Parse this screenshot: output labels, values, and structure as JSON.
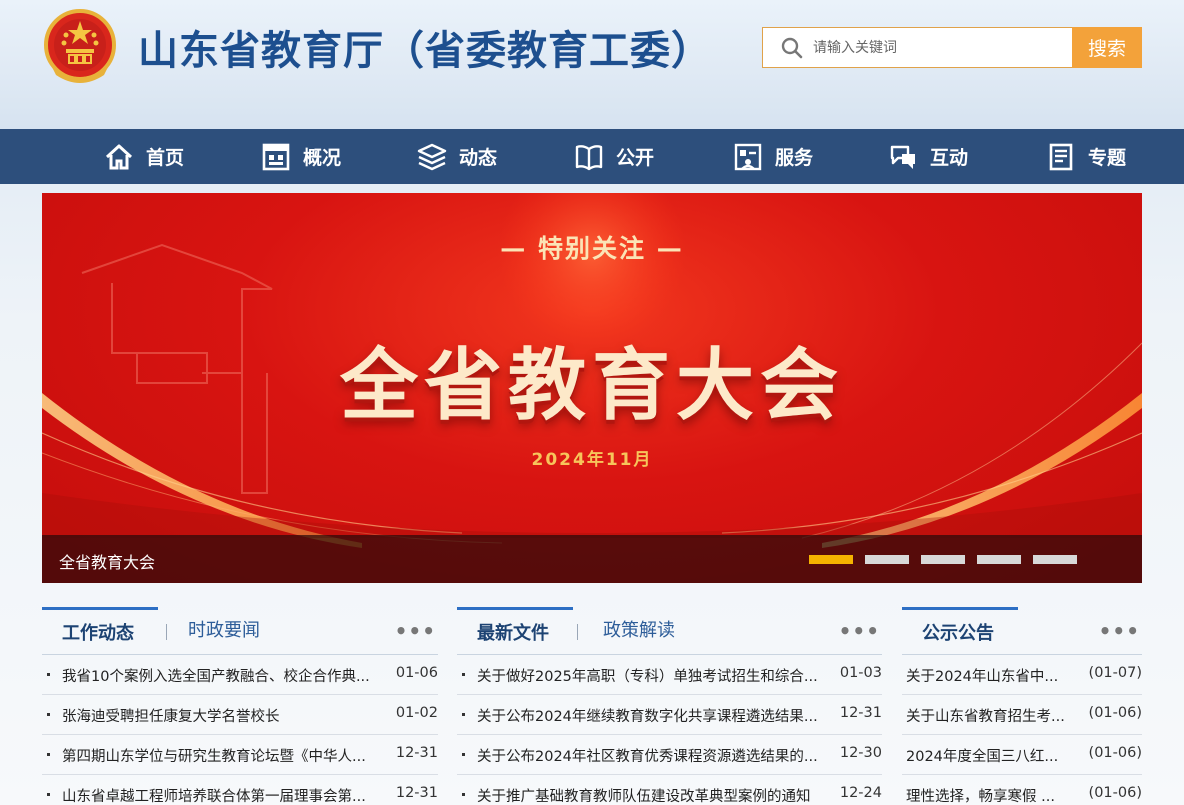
{
  "header": {
    "title": "山东省教育厅（省委教育工委）",
    "search_placeholder": "请输入关键词",
    "search_button": "搜索"
  },
  "nav": [
    {
      "label": "首页",
      "icon": "home-icon"
    },
    {
      "label": "概况",
      "icon": "building-icon"
    },
    {
      "label": "动态",
      "icon": "layers-icon"
    },
    {
      "label": "公开",
      "icon": "book-icon"
    },
    {
      "label": "服务",
      "icon": "service-icon"
    },
    {
      "label": "互动",
      "icon": "chat-icon"
    },
    {
      "label": "专题",
      "icon": "document-icon"
    }
  ],
  "banner": {
    "kicker": "— 特别关注 —",
    "headline": "全省教育大会",
    "date": "2024年11月",
    "caption": "全省教育大会",
    "slides": 5,
    "active_slide": 1
  },
  "columns": [
    {
      "active_tab": "工作动态",
      "inactive_tab": "时政要闻",
      "more": "•••",
      "items": [
        {
          "title": "我省10个案例入选全国产教融合、校企合作典...",
          "date": "01-06"
        },
        {
          "title": "张海迪受聘担任康复大学名誉校长",
          "date": "01-02"
        },
        {
          "title": "第四期山东学位与研究生教育论坛暨《中华人...",
          "date": "12-31"
        },
        {
          "title": "山东省卓越工程师培养联合体第一届理事会第...",
          "date": "12-31"
        }
      ]
    },
    {
      "active_tab": "最新文件",
      "inactive_tab": "政策解读",
      "more": "•••",
      "items": [
        {
          "title": "关于做好2025年高职（专科）单独考试招生和综合...",
          "date": "01-03"
        },
        {
          "title": "关于公布2024年继续教育数字化共享课程遴选结果...",
          "date": "12-31"
        },
        {
          "title": "关于公布2024年社区教育优秀课程资源遴选结果的...",
          "date": "12-30"
        },
        {
          "title": "关于推广基础教育教师队伍建设改革典型案例的通知",
          "date": "12-24"
        }
      ]
    },
    {
      "active_tab": "公示公告",
      "more": "•••",
      "items": [
        {
          "title": "关于2024年山东省中...",
          "date": "(01-07)"
        },
        {
          "title": "关于山东省教育招生考...",
          "date": "(01-06)"
        },
        {
          "title": "2024年度全国三八红...",
          "date": "(01-06)"
        },
        {
          "title": "理性选择，畅享寒假 ...",
          "date": "(01-06)"
        }
      ]
    }
  ],
  "colors": {
    "nav_bg": "#2d4f7c",
    "title_blue": "#1d4f8f",
    "search_orange": "#f3a23a",
    "banner_red": "#d81411",
    "dot_active": "#f5b300"
  }
}
